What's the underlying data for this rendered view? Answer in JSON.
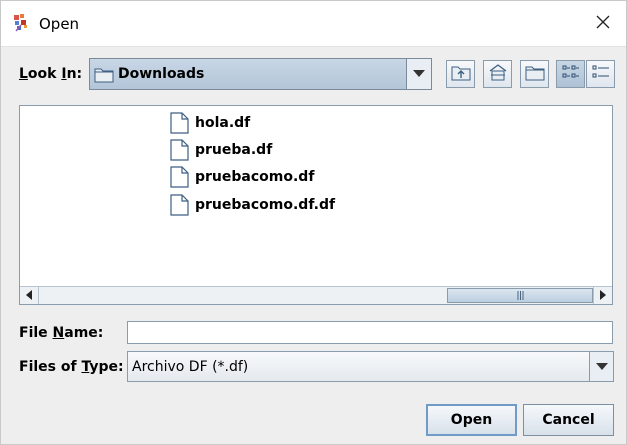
{
  "window": {
    "title": "Open",
    "close_glyph": "✕"
  },
  "look_in": {
    "label": "Look In:",
    "value": "Downloads"
  },
  "toolbar": {
    "buttons": [
      "up-one-level-icon",
      "home-icon",
      "new-folder-icon",
      "list-view-icon",
      "details-view-icon"
    ],
    "selected": "list-view-icon"
  },
  "files": [
    {
      "name": "hola.df"
    },
    {
      "name": "prueba.df"
    },
    {
      "name": "pruebacomo.df"
    },
    {
      "name": "pruebacomo.df.df"
    }
  ],
  "file_name": {
    "label": "File Name:",
    "value": ""
  },
  "files_of_type": {
    "label": "Files of Type:",
    "value": "Archivo DF (*.df)"
  },
  "buttons": {
    "open": "Open",
    "cancel": "Cancel"
  },
  "colors": {
    "combo_selected": "#b3c5d8",
    "border": "#8a9bab",
    "default_button_border": "#6f9bc6"
  }
}
